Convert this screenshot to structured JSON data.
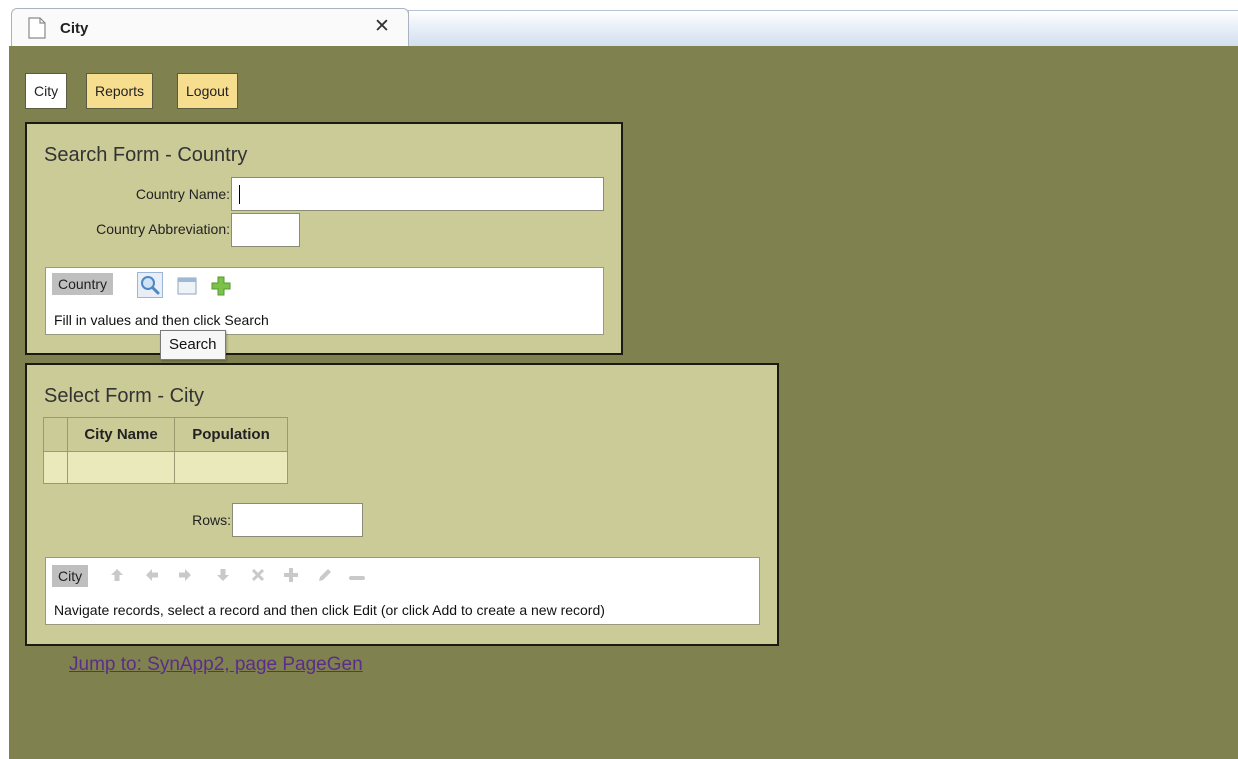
{
  "browser": {
    "tab_title": "City",
    "close_glyph": "✕"
  },
  "nav": {
    "items": [
      {
        "label": "City",
        "active": true
      },
      {
        "label": "Reports",
        "active": false
      },
      {
        "label": "Logout",
        "active": false
      }
    ]
  },
  "search_form": {
    "title": "Search Form - Country",
    "country_name_label": "Country Name:",
    "country_name_value": "",
    "country_abbrev_label": "Country Abbreviation:",
    "country_abbrev_value": "",
    "toolbar": {
      "label": "Country",
      "icons": [
        "search-icon",
        "clear-form-icon",
        "add-icon"
      ],
      "message": "Fill in values and then click Search"
    },
    "tooltip": "Search"
  },
  "select_form": {
    "title": "Select Form - City",
    "columns": [
      "",
      "City Name",
      "Population"
    ],
    "rows": [
      [
        "",
        "",
        ""
      ]
    ],
    "rows_label": "Rows:",
    "rows_value": "",
    "toolbar": {
      "label": "City",
      "icons": [
        "first-record-icon",
        "previous-record-icon",
        "next-record-icon",
        "last-record-icon",
        "delete-icon",
        "add-icon",
        "edit-icon",
        "remove-icon"
      ],
      "message": "Navigate records, select a record and then click Edit (or click Add to create a new record)"
    }
  },
  "jump_link": "Jump to: SynApp2, page PageGen",
  "colors": {
    "page_bg": "#7f814f",
    "panel_bg": "#cbcb98",
    "nav_inactive": "#f7dd8e",
    "link": "#5b2d8a"
  }
}
